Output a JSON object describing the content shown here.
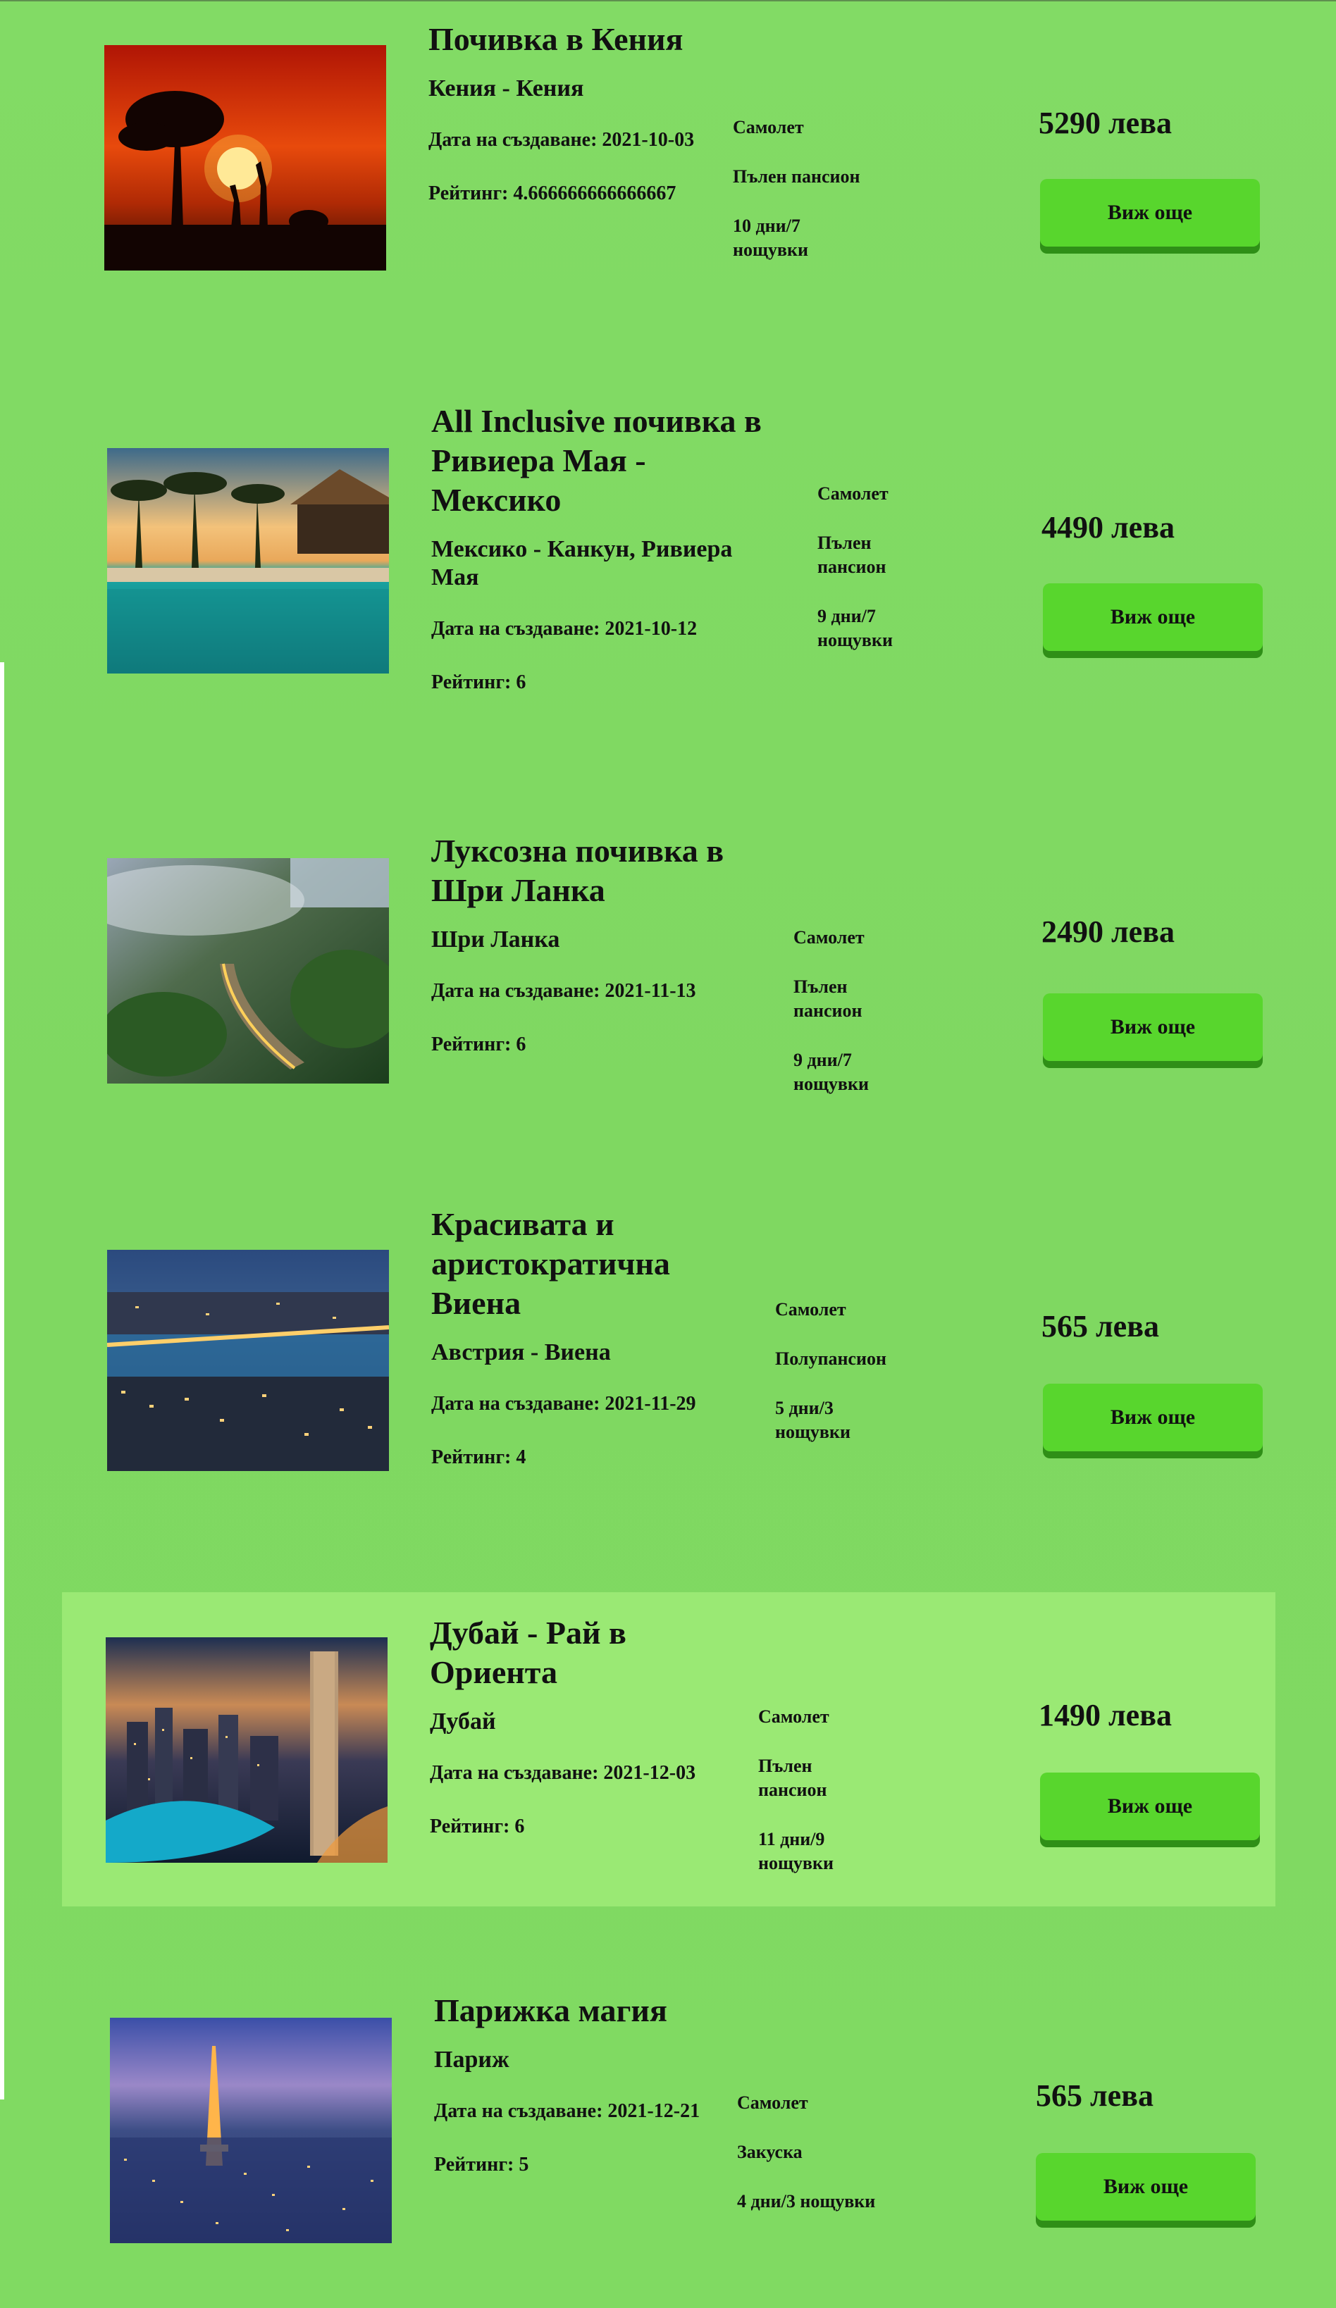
{
  "offers": [
    {
      "title": "Почивка в Кения",
      "location": "Кения - Кения",
      "created": "Дата на създаване: 2021-10-03",
      "rating": "Рейтинг: 4.666666666666667",
      "transport": "Самолет",
      "board": "Пълен пансион",
      "duration": "10 дни/7 нощувки",
      "price": "5290 лева",
      "button": "Виж още",
      "image": "kenya-sunset-safari"
    },
    {
      "title": "All Inclusive почивка в Ривиера Мая - Мексико",
      "location": "Мексико - Канкун, Ривиера Мая",
      "created": "Дата на създаване: 2021-10-12",
      "rating": "Рейтинг: 6",
      "transport": "Самолет",
      "board": "Пълен пансион",
      "duration": "9 дни/7 нощувки",
      "price": "4490 лева",
      "button": "Виж още",
      "image": "riviera-maya-pool"
    },
    {
      "title": "Луксозна почивка в Шри Ланка",
      "location": "Шри Ланка",
      "created": "Дата на създаване: 2021-11-13",
      "rating": "Рейтинг: 6",
      "transport": "Самолет",
      "board": "Пълен пансион",
      "duration": "9 дни/7 нощувки",
      "price": "2490 лева",
      "button": "Виж още",
      "image": "sri-lanka-train-bridge"
    },
    {
      "title": "Красивата и аристократична Виена",
      "location": "Австрия - Виена",
      "created": "Дата на създаване: 2021-11-29",
      "rating": "Рейтинг: 4",
      "transport": "Самолет",
      "board": "Полупансион",
      "duration": "5 дни/3 нощувки",
      "price": "565 лева",
      "button": "Виж още",
      "image": "vienna-night"
    },
    {
      "title": "Дубай - Рай в Ориента",
      "location": "Дубай",
      "created": "Дата на създаване: 2021-12-03",
      "rating": "Рейтинг: 6",
      "transport": "Самолет",
      "board": "Пълен пансион",
      "duration": "11 дни/9 нощувки",
      "price": "1490 лева",
      "button": "Виж още",
      "image": "dubai-marina"
    },
    {
      "title": "Парижка магия",
      "location": "Париж",
      "created": "Дата на създаване: 2021-12-21",
      "rating": "Рейтинг: 5",
      "transport": "Самолет",
      "board": "Закуска",
      "duration": "4 дни/3 нощувки",
      "price": "565 лева",
      "button": "Виж още",
      "image": "paris-eiffel-dusk"
    }
  ]
}
